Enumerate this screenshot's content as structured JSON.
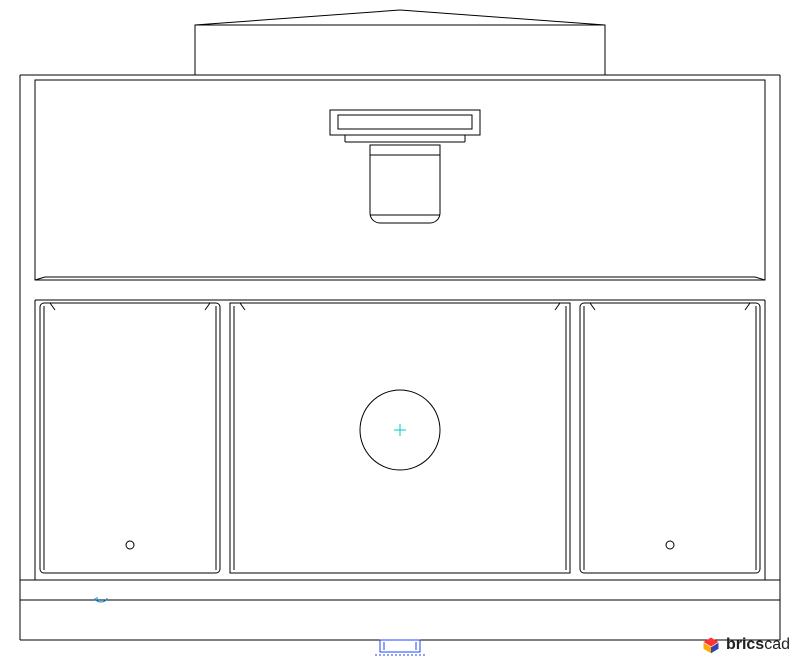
{
  "watermark": {
    "brand_bold": "brics",
    "brand_light": "cad"
  },
  "drawing": {
    "type": "cad-elevation-view",
    "description": "Mechanical unit front elevation (likely HVAC / air handling unit)",
    "stroke_main": "#000000",
    "stroke_accent": "#00aaff",
    "stroke_annotation": "#0066ff",
    "center_marker": "+",
    "elements": [
      "outer-frame",
      "top-cap-panel",
      "upper-compartment",
      "fan-motor-assembly",
      "motor-bracket",
      "lower-compartment",
      "left-access-panel",
      "center-panel",
      "right-access-panel",
      "circular-port",
      "left-drain-hole",
      "right-drain-hole",
      "base-connection-detail"
    ]
  }
}
